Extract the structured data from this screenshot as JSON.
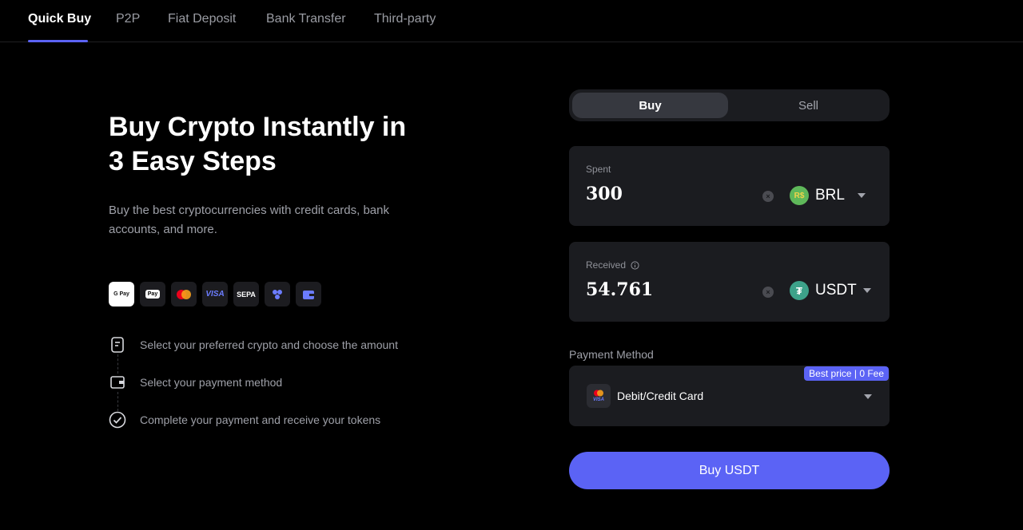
{
  "tabs": [
    {
      "label": "Quick Buy",
      "active": true
    },
    {
      "label": "P2P",
      "active": false
    },
    {
      "label": "Fiat Deposit",
      "active": false
    },
    {
      "label": "Bank Transfer",
      "active": false
    },
    {
      "label": "Third-party",
      "active": false
    }
  ],
  "hero": {
    "title_line1": "Buy Crypto Instantly in",
    "title_line2": "3 Easy Steps",
    "subtitle_line1": "Buy the best cryptocurrencies with credit cards, bank",
    "subtitle_line2": "accounts, and more."
  },
  "payment_icons": [
    {
      "name": "google-pay-icon",
      "text": "G Pay"
    },
    {
      "name": "apple-pay-icon",
      "text": "Pay"
    },
    {
      "name": "mastercard-icon",
      "text": ""
    },
    {
      "name": "visa-icon",
      "text": "VISA"
    },
    {
      "name": "sepa-icon",
      "text": "SEPA"
    },
    {
      "name": "pix-icon",
      "text": ""
    },
    {
      "name": "wallet-icon",
      "text": ""
    }
  ],
  "steps": [
    {
      "text": "Select your preferred crypto and choose the amount",
      "icon": "document-icon"
    },
    {
      "text": "Select your payment method",
      "icon": "wallet-icon"
    },
    {
      "text": "Complete your payment and receive your tokens",
      "icon": "check-circle-icon"
    }
  ],
  "trade": {
    "buy_label": "Buy",
    "sell_label": "Sell",
    "spent": {
      "label": "Spent",
      "value": "300",
      "currency": "BRL",
      "currency_symbol": "R$",
      "color": "#5fb85a"
    },
    "received": {
      "label": "Received",
      "value": "54.761",
      "currency": "USDT",
      "currency_symbol": "₮",
      "color": "#3da28a"
    },
    "payment_method_label": "Payment Method",
    "payment_method": "Debit/Credit Card",
    "badge": "Best price | 0 Fee",
    "button_label": "Buy USDT"
  },
  "colors": {
    "accent": "#5b63f5",
    "background": "#000000",
    "card": "#1b1c20"
  }
}
